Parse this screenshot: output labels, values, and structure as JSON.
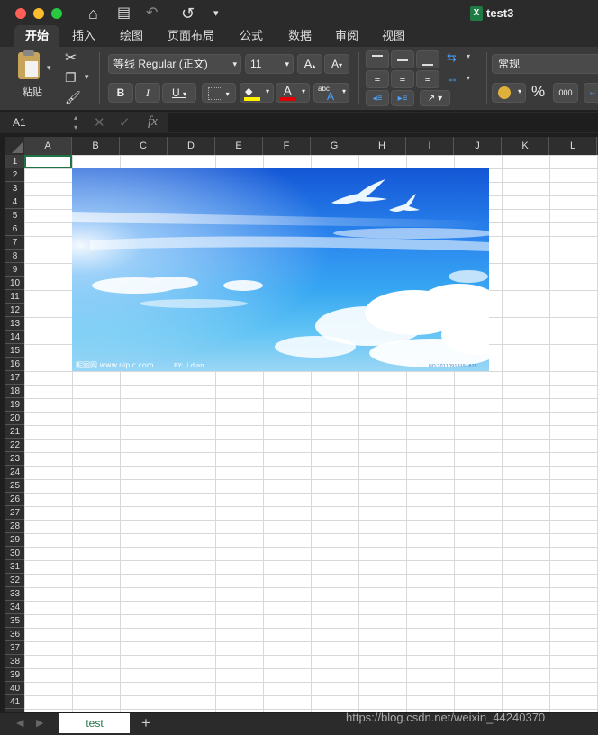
{
  "window": {
    "title": "test3",
    "excel_icon": "X"
  },
  "toolbar": {
    "home": "⌂",
    "save": "▤",
    "undo": "↶",
    "redo": "↺",
    "more": "▾"
  },
  "tabs": [
    "开始",
    "插入",
    "绘图",
    "页面布局",
    "公式",
    "数据",
    "审阅",
    "视图"
  ],
  "ribbon": {
    "paste_label": "粘贴",
    "font_name": "等线 Regular (正文)",
    "font_size": "11",
    "grow": "A",
    "shrink": "A",
    "bold": "B",
    "italic": "I",
    "underline": "U",
    "font_color_letter": "A",
    "abc": "abc",
    "number_format": "常规",
    "percent": "%",
    "thousands": "000"
  },
  "formula_bar": {
    "cell_ref": "A1",
    "fx": "fx",
    "value": ""
  },
  "columns": [
    "A",
    "B",
    "C",
    "D",
    "E",
    "F",
    "G",
    "H",
    "I",
    "J",
    "K",
    "L"
  ],
  "rows": [
    "1",
    "2",
    "3",
    "4",
    "5",
    "6",
    "7",
    "8",
    "9",
    "10",
    "11",
    "12",
    "13",
    "14",
    "15",
    "16",
    "17",
    "18",
    "19",
    "20",
    "21",
    "22",
    "23",
    "24",
    "25",
    "26",
    "27",
    "28",
    "29",
    "30",
    "31",
    "32",
    "33",
    "34",
    "35",
    "36",
    "37",
    "38",
    "39",
    "40",
    "41"
  ],
  "picture": {
    "caption_left": "昵图网 www.nipic.com",
    "caption_by": "BY: li.dian",
    "caption_right": "NO:20110918151825"
  },
  "sheets": [
    "test"
  ],
  "add_sheet": "+",
  "watermark": "https://blog.csdn.net/weixin_44240370"
}
